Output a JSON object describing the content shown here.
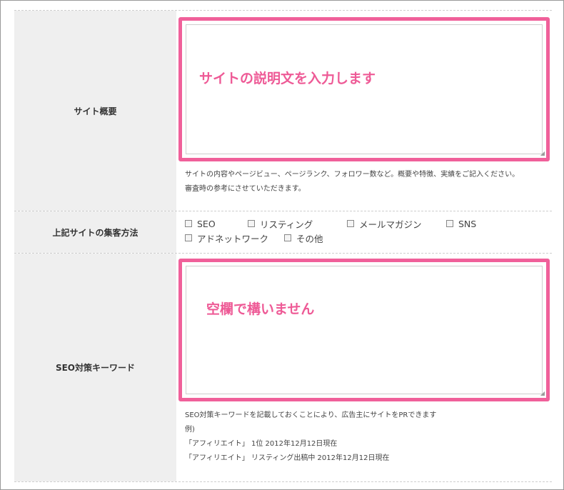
{
  "fields": {
    "site_summary": {
      "label": "サイト概要",
      "value": "",
      "annotation": "サイトの説明文を入力します",
      "help": [
        "サイトの内容やページビュー、ページランク、フォロワー数など。概要や特徴、実績をご記入ください。",
        "審査時の参考にさせていただきます。"
      ]
    },
    "traffic_methods": {
      "label": "上記サイトの集客方法",
      "options": [
        {
          "label": "SEO",
          "checked": false
        },
        {
          "label": "リスティング",
          "checked": false
        },
        {
          "label": "メールマガジン",
          "checked": false
        },
        {
          "label": "SNS",
          "checked": false
        },
        {
          "label": "アドネットワーク",
          "checked": false
        },
        {
          "label": "その他",
          "checked": false
        }
      ]
    },
    "seo_keywords": {
      "label": "SEO対策キーワード",
      "value": "",
      "annotation": "空欄で構いません",
      "help": [
        "SEO対策キーワードを記載しておくことにより、広告主にサイトをPRできます",
        "例)",
        "「アフィリエイト」 1位 2012年12月12日現在",
        "「アフィリエイト」 リスティング出稿中 2012年12月12日現在"
      ]
    }
  },
  "colors": {
    "highlight_border": "#f0609a",
    "annotation_text": "#ee5a96",
    "label_background": "#efefef"
  }
}
